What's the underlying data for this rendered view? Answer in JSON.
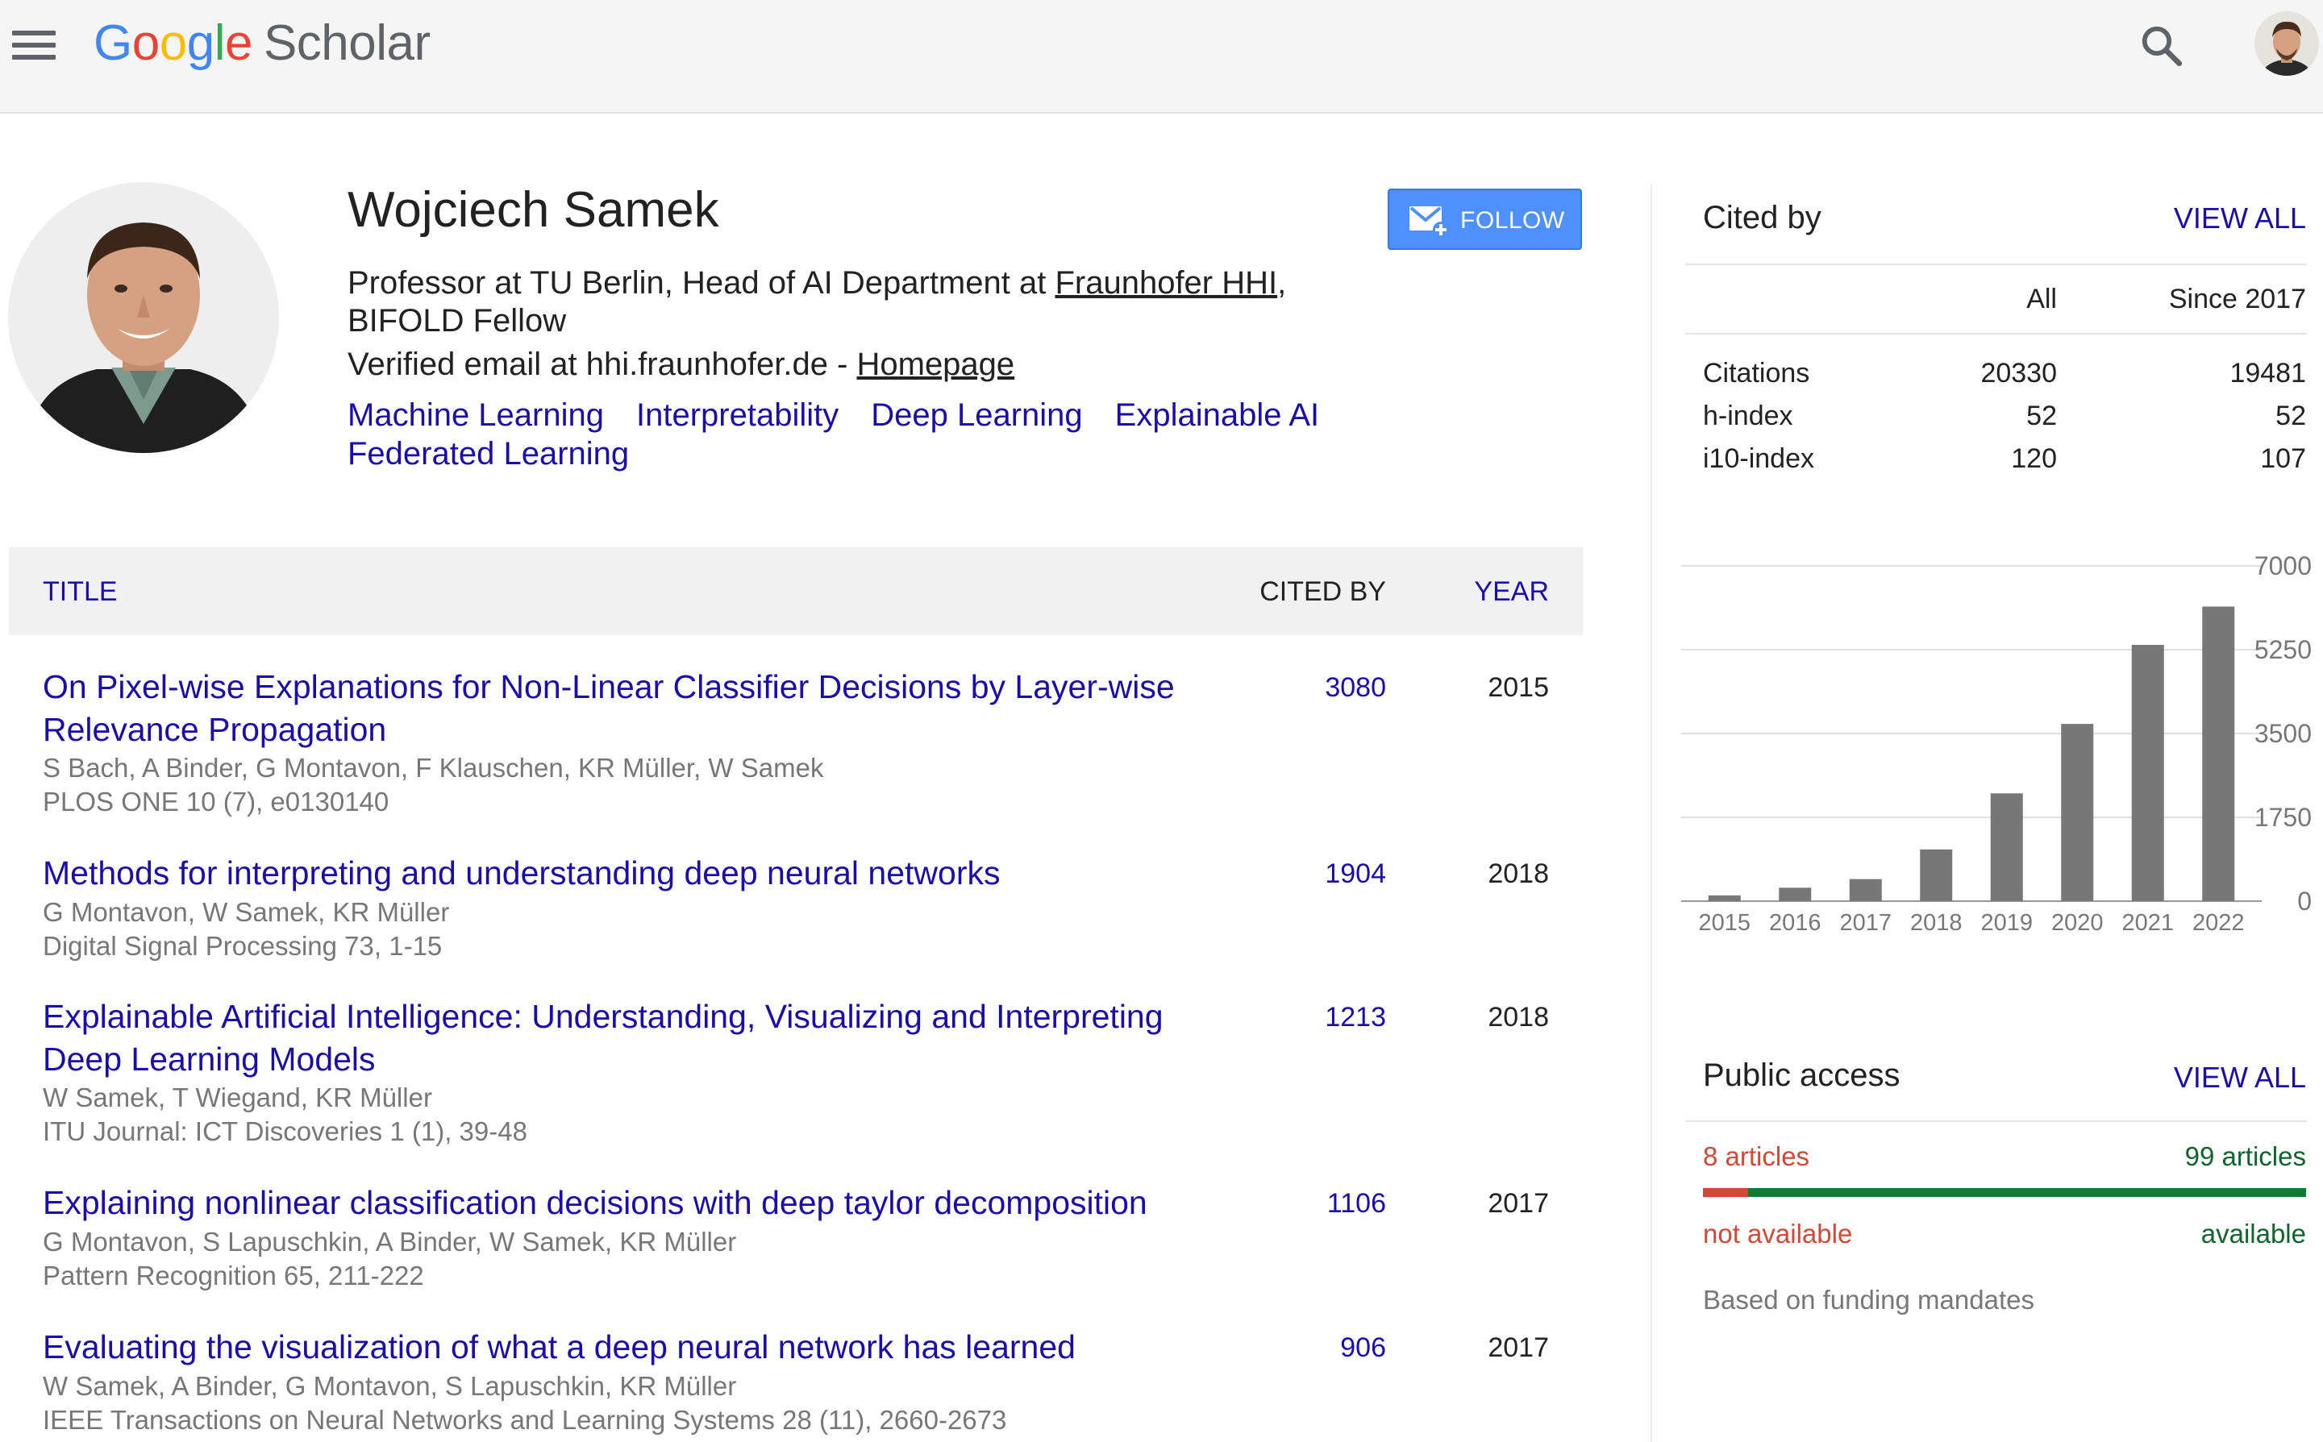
{
  "header": {
    "logo_google": [
      {
        "ch": "G",
        "color": "#4285F4"
      },
      {
        "ch": "o",
        "color": "#EA4335"
      },
      {
        "ch": "o",
        "color": "#FBBC05"
      },
      {
        "ch": "g",
        "color": "#4285F4"
      },
      {
        "ch": "l",
        "color": "#34A853"
      },
      {
        "ch": "e",
        "color": "#EA4335"
      }
    ],
    "logo_scholar": "Scholar",
    "icons": {
      "menu": "menu-icon",
      "search": "search-icon",
      "account": "account-avatar"
    }
  },
  "profile": {
    "name": "Wojciech Samek",
    "affiliation_prefix": "Professor at TU Berlin, Head of AI Department at ",
    "affiliation_link": "Fraunhofer HHI",
    "affiliation_suffix": ", BIFOLD Fellow",
    "email_text": "Verified email at hhi.fraunhofer.de - ",
    "homepage_label": "Homepage",
    "interests": [
      "Machine Learning",
      "Interpretability",
      "Deep Learning",
      "Explainable AI",
      "Federated Learning"
    ],
    "follow_label": "FOLLOW"
  },
  "articles_table": {
    "headers": {
      "title": "TITLE",
      "cited_by": "CITED BY",
      "year": "YEAR"
    },
    "rows": [
      {
        "title": "On Pixel-wise Explanations for Non-Linear Classifier Decisions by Layer-wise Relevance Propagation",
        "authors": "S Bach, A Binder, G Montavon, F Klauschen, KR Müller, W Samek",
        "venue": "PLOS ONE 10 (7), e0130140",
        "cited": "3080",
        "year": "2015"
      },
      {
        "title": "Methods for interpreting and understanding deep neural networks",
        "authors": "G Montavon, W Samek, KR Müller",
        "venue": "Digital Signal Processing 73, 1-15",
        "cited": "1904",
        "year": "2018"
      },
      {
        "title": "Explainable Artificial Intelligence: Understanding, Visualizing and Interpreting Deep Learning Models",
        "authors": "W Samek, T Wiegand, KR Müller",
        "venue": "ITU Journal: ICT Discoveries 1 (1), 39-48",
        "cited": "1213",
        "year": "2018"
      },
      {
        "title": "Explaining nonlinear classification decisions with deep taylor decomposition",
        "authors": "G Montavon, S Lapuschkin, A Binder, W Samek, KR Müller",
        "venue": "Pattern Recognition 65, 211-222",
        "cited": "1106",
        "year": "2017"
      },
      {
        "title": "Evaluating the visualization of what a deep neural network has learned",
        "authors": "W Samek, A Binder, G Montavon, S Lapuschkin, KR Müller",
        "venue": "IEEE Transactions on Neural Networks and Learning Systems 28 (11), 2660-2673",
        "cited": "906",
        "year": "2017"
      }
    ]
  },
  "cited_by": {
    "title": "Cited by",
    "view_all": "VIEW ALL",
    "col_all": "All",
    "col_since": "Since 2017",
    "rows": [
      {
        "label": "Citations",
        "all": "20330",
        "since": "19481"
      },
      {
        "label": "h-index",
        "all": "52",
        "since": "52"
      },
      {
        "label": "i10-index",
        "all": "120",
        "since": "107"
      }
    ]
  },
  "chart_data": {
    "type": "bar",
    "categories": [
      "2015",
      "2016",
      "2017",
      "2018",
      "2019",
      "2020",
      "2021",
      "2022"
    ],
    "values": [
      120,
      280,
      460,
      1080,
      2250,
      3700,
      5350,
      6150
    ],
    "ylim": [
      0,
      7000
    ],
    "yticks": [
      "7000",
      "5250",
      "3500",
      "1750",
      "0"
    ],
    "bar_color": "#777777",
    "grid": true
  },
  "public_access": {
    "title": "Public access",
    "view_all": "VIEW ALL",
    "unavailable_count": "8 articles",
    "available_count": "99 articles",
    "unavailable_label": "not available",
    "available_label": "available",
    "unavailable_fraction": 0.075,
    "note": "Based on funding mandates",
    "colors": {
      "unavailable": "#d14836",
      "available": "#0f7b34"
    }
  }
}
